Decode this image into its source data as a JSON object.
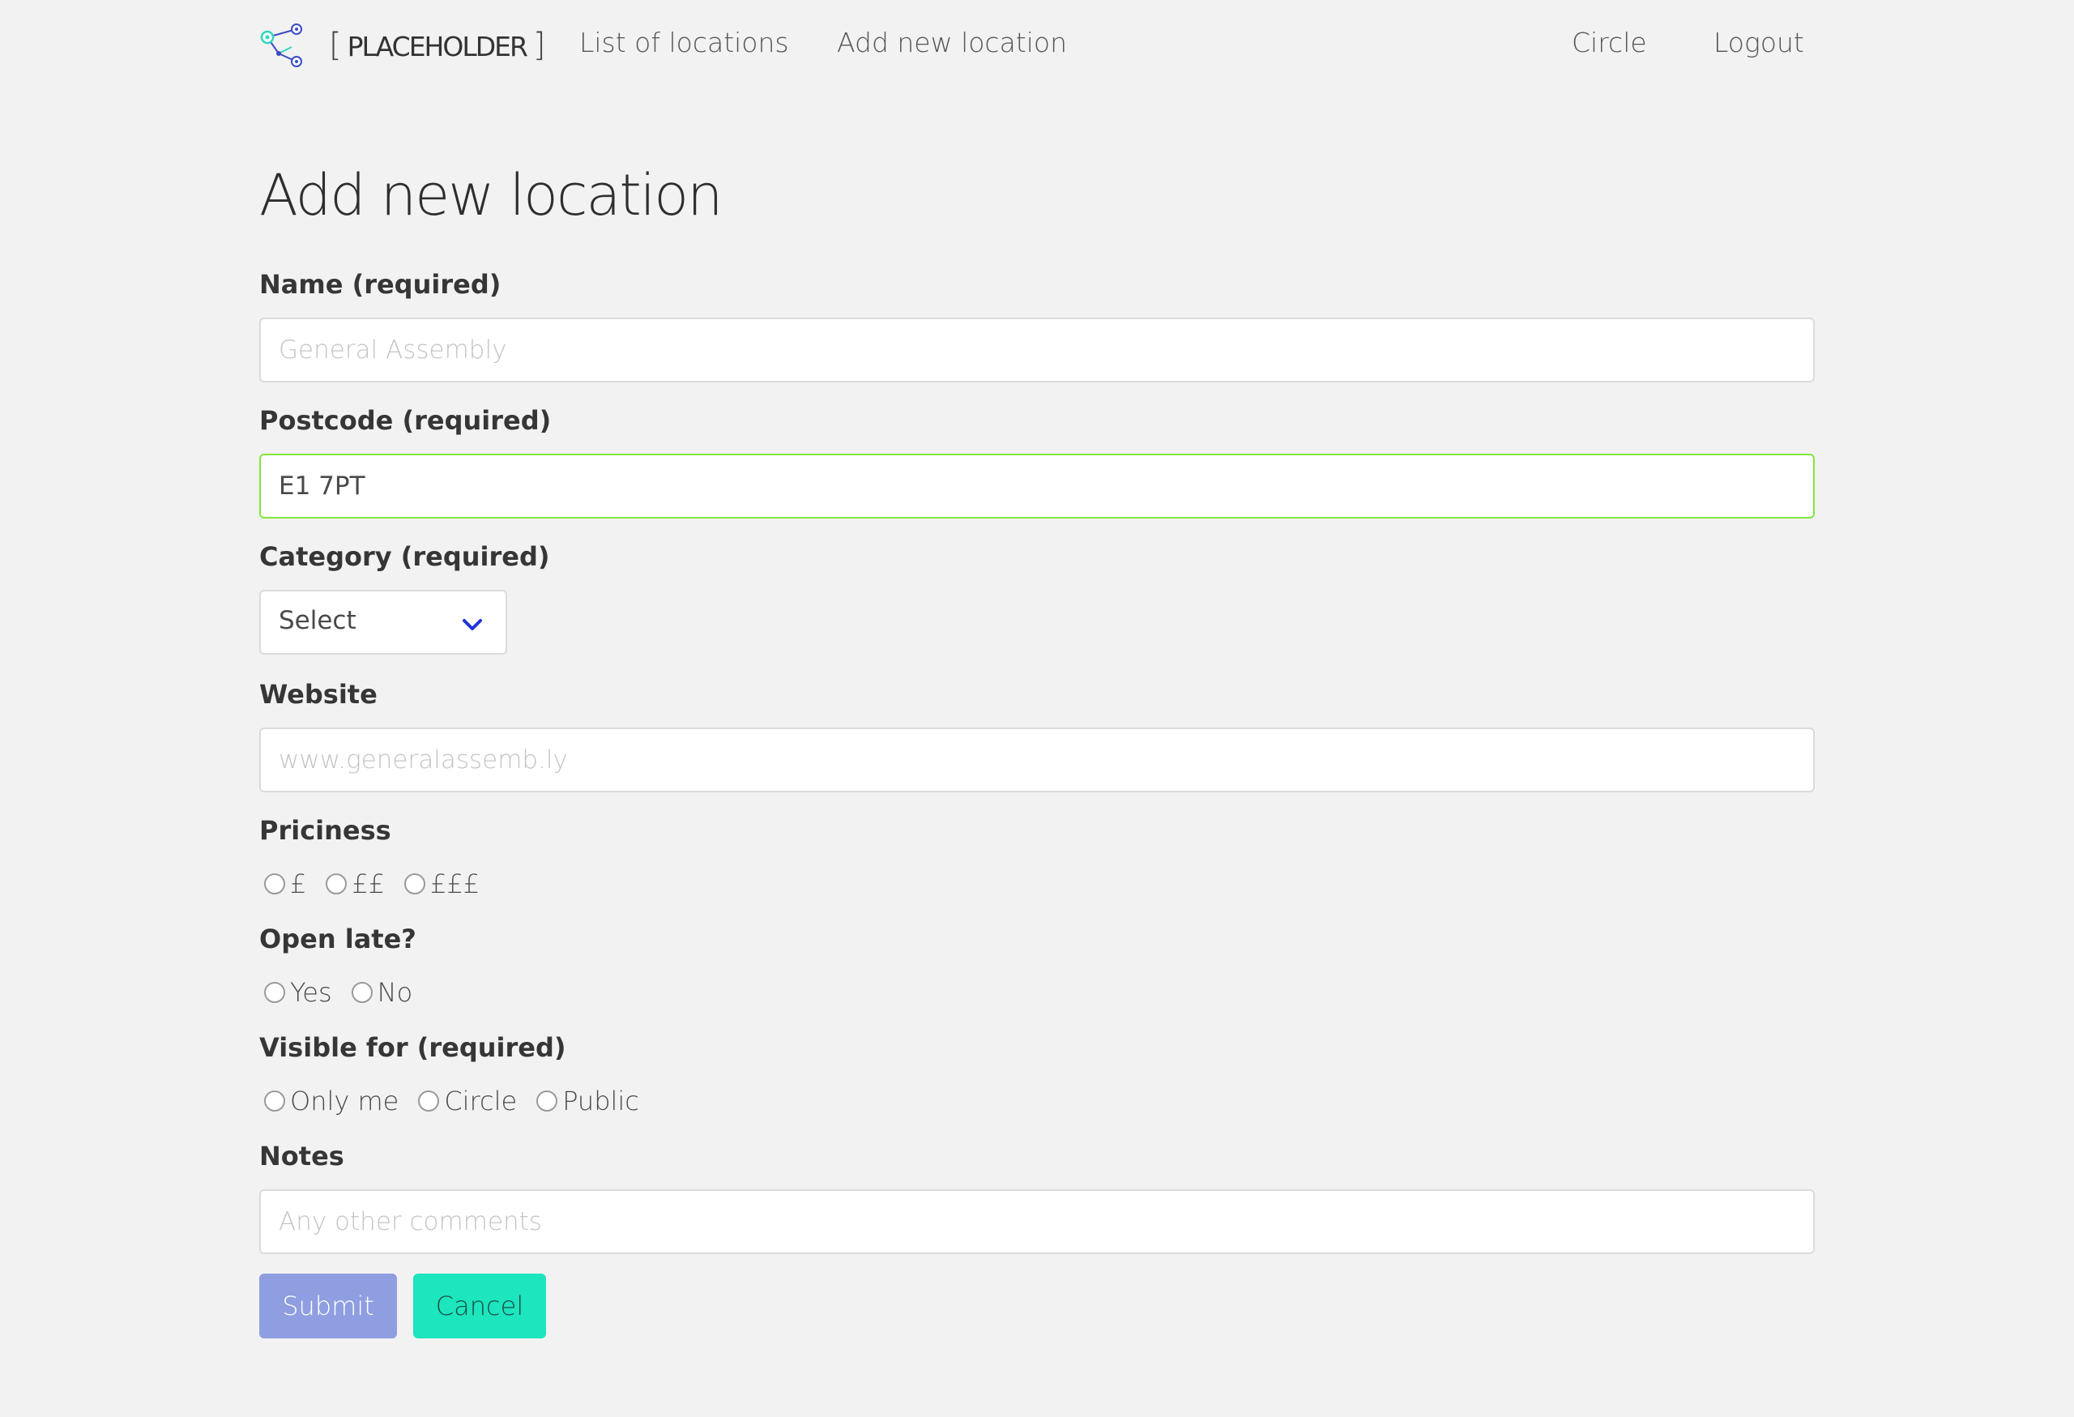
{
  "navbar": {
    "brand": {
      "bracket_open": "[",
      "name": "PLACEHOLDER",
      "bracket_close": "]"
    },
    "links": [
      {
        "label": "List of locations"
      },
      {
        "label": "Add new location"
      }
    ],
    "right_links": [
      {
        "label": "Circle"
      },
      {
        "label": "Logout"
      }
    ]
  },
  "page": {
    "title": "Add new location"
  },
  "form": {
    "name": {
      "label": "Name (required)",
      "placeholder": "General Assembly",
      "value": ""
    },
    "postcode": {
      "label": "Postcode (required)",
      "value": "E1 7PT"
    },
    "category": {
      "label": "Category (required)",
      "selected": "Select"
    },
    "website": {
      "label": "Website",
      "placeholder": "www.generalassemb.ly",
      "value": ""
    },
    "priciness": {
      "label": "Priciness",
      "options": [
        "£",
        "££",
        "£££"
      ]
    },
    "open_late": {
      "label": "Open late?",
      "options": [
        "Yes",
        "No"
      ]
    },
    "visible_for": {
      "label": "Visible for (required)",
      "options": [
        "Only me",
        "Circle",
        "Public"
      ]
    },
    "notes": {
      "label": "Notes",
      "placeholder": "Any other comments",
      "value": ""
    },
    "buttons": {
      "submit": "Submit",
      "cancel": "Cancel"
    }
  },
  "colors": {
    "background": "#f2f2f2",
    "success_border": "#7ee83a",
    "submit_bg": "#8f9ee0",
    "cancel_bg": "#1de5be",
    "select_arrow": "#1f35d6",
    "logo_teal": "#2fd6c0",
    "logo_blue": "#3b4bc4"
  }
}
